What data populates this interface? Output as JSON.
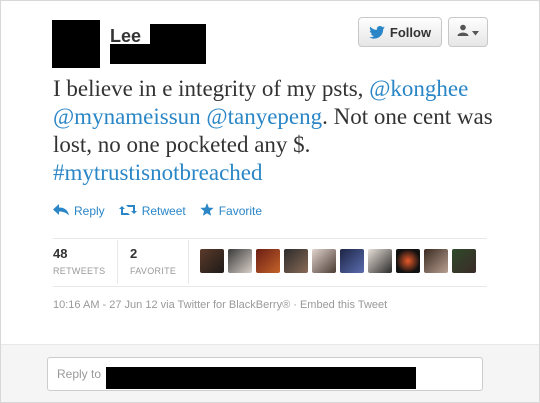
{
  "user": {
    "name_visible": "Lee"
  },
  "header": {
    "follow_label": "Follow"
  },
  "tweet": {
    "text_1": "I believe in e integrity of my psts, ",
    "mention_1": "@konghee",
    "mention_2": "@mynameissun",
    "mention_3": "@tanyepeng",
    "text_2": ". Not one cent was lost, no one pocketed any $. ",
    "hashtag": "#mytrustisnotbreached"
  },
  "actions": {
    "reply": "Reply",
    "retweet": "Retweet",
    "favorite": "Favorite"
  },
  "stats": {
    "retweets_count": "48",
    "retweets_label": "RETWEETS",
    "favorite_count": "2",
    "favorite_label": "FAVORITE"
  },
  "meta": {
    "timestamp_line": "10:16 AM - 27 Jun 12 via Twitter for BlackBerry® · Embed this Tweet"
  },
  "reply_box": {
    "placeholder": "Reply to"
  },
  "colors": {
    "link": "#2a86c6",
    "text": "#333333",
    "muted": "#999999"
  },
  "icons": {
    "follow": "twitter-bird-icon",
    "user_menu": "user-icon",
    "reply": "reply-arrow-icon",
    "retweet": "retweet-icon",
    "favorite": "star-icon"
  }
}
